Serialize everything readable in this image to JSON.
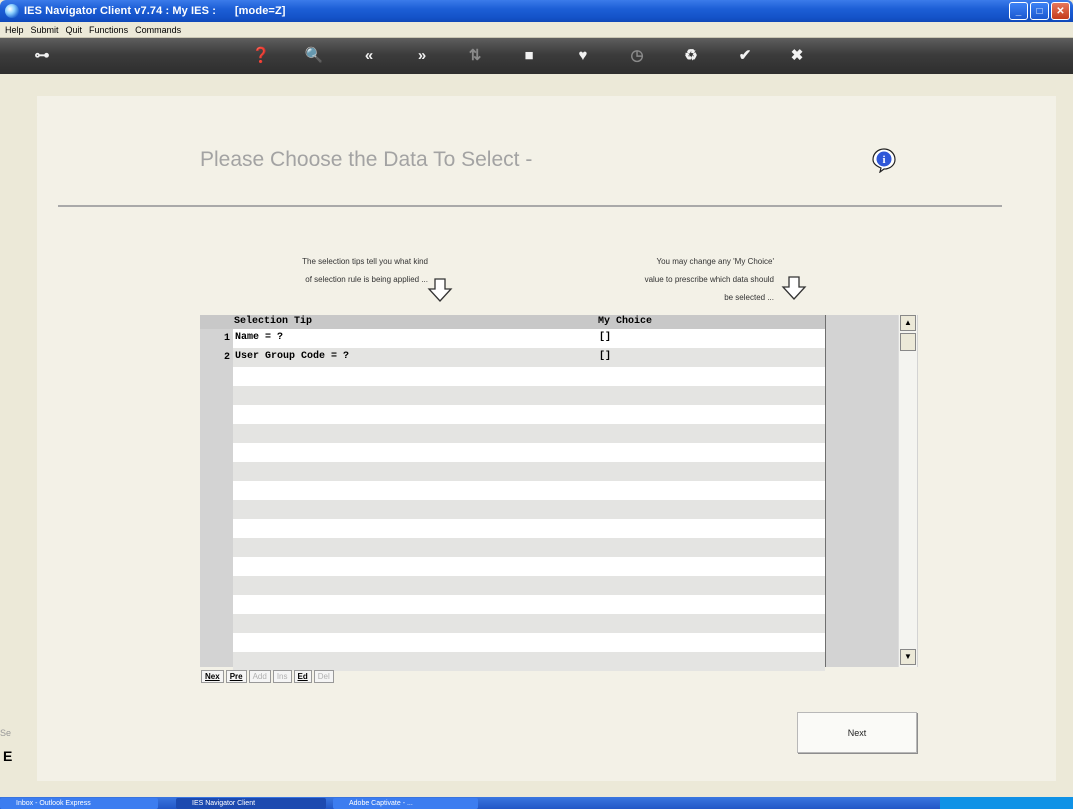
{
  "window": {
    "title": "IES Navigator Client v7.74 : My IES :      [mode=Z]"
  },
  "menu": {
    "items": [
      "Help",
      "Submit",
      "Quit",
      "Functions",
      "Commands"
    ]
  },
  "toolbar": {
    "icons": [
      "key-icon",
      "help-icon",
      "search-icon",
      "previous-icon",
      "next-icon",
      "sort-icon",
      "stop-icon",
      "favorite-icon",
      "clock-icon",
      "refresh-icon",
      "ok-icon",
      "close-icon"
    ]
  },
  "page": {
    "title": "Please Choose the Data To Select -",
    "tip_left_line1": "The selection tips tell you what kind",
    "tip_left_line2": "of selection rule is being applied ...",
    "tip_right_line1": "You may change any 'My Choice'",
    "tip_right_line2": "value to prescribe which data should",
    "tip_right_line3": "be selected ..."
  },
  "grid": {
    "columns": {
      "tip": "Selection Tip",
      "choice": "My Choice"
    },
    "rows": [
      {
        "num": "1",
        "tip": "Name = ?",
        "choice": "[]"
      },
      {
        "num": "2",
        "tip": "User Group Code = ?",
        "choice": "[]"
      }
    ],
    "nav": {
      "nex": "Nex",
      "pre": "Pre",
      "add": "Add",
      "ins": "Ins",
      "ed": "Ed",
      "del": "Del"
    }
  },
  "buttons": {
    "next": "Next"
  },
  "fragments": {
    "left_se": "Se",
    "left_e": "E"
  },
  "taskbar": {
    "tasks": [
      "Inbox - Outlook Express",
      "IES Navigator Client",
      "Adobe Captivate - ..."
    ]
  },
  "colors": {
    "title_bar": "#1452c8",
    "toolbar": "#3c3c3c",
    "panel": "#f3f1e7",
    "grid_row_alt": "#e4e4e2"
  }
}
